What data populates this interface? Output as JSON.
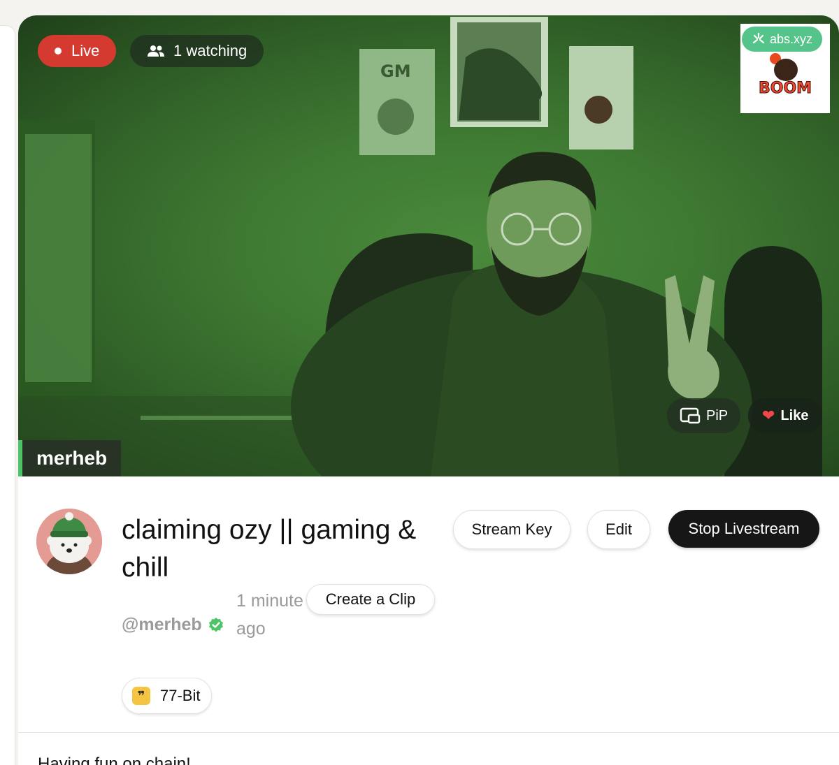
{
  "stream": {
    "live_label": "Live",
    "watching_label": "1 watching",
    "sponsor_chip": "abs.xyz",
    "sponsor_logo": "BOOM",
    "pip_label": "PiP",
    "like_label": "Like",
    "streamer_tag": "merheb",
    "poster_texts": [
      "GM"
    ]
  },
  "info": {
    "title": "claiming ozy || gaming & chill",
    "handle": "@merheb",
    "time_ago": "1 minute ago",
    "tag": "77-Bit",
    "stream_key_label": "Stream Key",
    "edit_label": "Edit",
    "stop_label": "Stop Livestream",
    "clip_label": "Create a Clip",
    "description": "Having fun on chain!"
  },
  "colors": {
    "live": "#d43a2f",
    "verified": "#4cc467",
    "stop_button": "#161616",
    "accent_green": "#55c48a"
  },
  "icons": {
    "live": "live-dot-icon",
    "watching": "people-icon",
    "sponsor": "abs-logo-icon",
    "pip": "pip-icon",
    "like": "heart-icon",
    "verified": "verified-check-icon",
    "tag": "quote-icon"
  }
}
